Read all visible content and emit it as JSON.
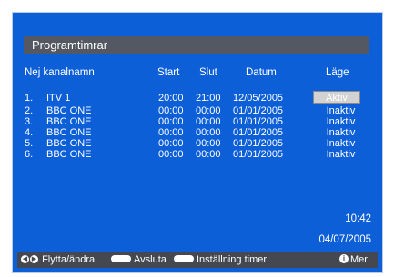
{
  "title": "Programtimrar",
  "columns": {
    "index_name": "Nej kanalnamn",
    "start": "Start",
    "stop": "Slut",
    "date": "Datum",
    "mode": "Läge"
  },
  "timers": [
    {
      "index": "1.",
      "channel": "ITV 1",
      "start": "20:00",
      "stop": "21:00",
      "date": "12/05/2005",
      "mode": "Aktiv"
    },
    {
      "index": "2.",
      "channel": "BBC ONE",
      "start": "00:00",
      "stop": "00:00",
      "date": "01/01/2005",
      "mode": "Inaktiv"
    },
    {
      "index": "3.",
      "channel": "BBC ONE",
      "start": "00:00",
      "stop": "00:00",
      "date": "01/01/2005",
      "mode": "Inaktiv"
    },
    {
      "index": "4.",
      "channel": "BBC ONE",
      "start": "00:00",
      "stop": "00:00",
      "date": "01/01/2005",
      "mode": "Inaktiv"
    },
    {
      "index": "5.",
      "channel": "BBC ONE",
      "start": "00:00",
      "stop": "00:00",
      "date": "01/01/2005",
      "mode": "Inaktiv"
    },
    {
      "index": "6.",
      "channel": "BBC ONE",
      "start": "00:00",
      "stop": "00:00",
      "date": "01/01/2005",
      "mode": "Inaktiv"
    }
  ],
  "clock": {
    "time": "10:42",
    "date": "04/07/2005"
  },
  "footer": {
    "move_label": "Flytta/ändra",
    "menu_key": "MENU",
    "exit_label": "Avsluta",
    "ok_key": "OK",
    "settings_label": "Inställning timer",
    "more_label": "Mer"
  },
  "colors": {
    "background": "#0d5fd8",
    "title_bar": "#545862",
    "footer_bar": "#454850",
    "selection": "#d2d2d2"
  }
}
